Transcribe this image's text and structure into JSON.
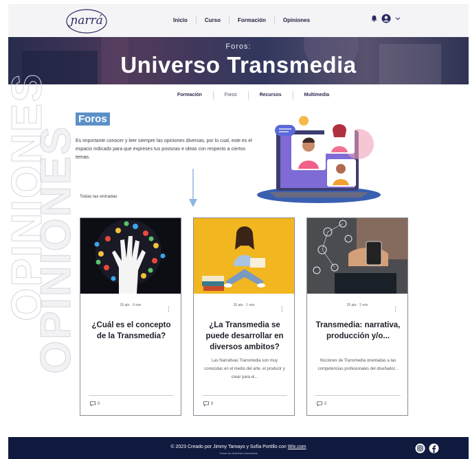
{
  "header": {
    "logo_text": "ɲarrá",
    "nav": [
      "Inicio",
      "Curso",
      "Formación",
      "Opiniones"
    ]
  },
  "banner": {
    "subtitle": "Foros:",
    "title": "Universo Transmedia"
  },
  "subnav": [
    "Formación",
    "Foros",
    "Recursos",
    "Multimedia"
  ],
  "watermark": "OPINIONES",
  "section_title": "Foros",
  "intro": "Es importante conocer y leer siempre las opiniones diversas, por lo cual, este es el espacio indicado para que expreses tus posturas e ideas con respecto a ciertos temas.",
  "all_entries": "Todas las entradas",
  "posts": [
    {
      "meta": "25 abr  ·  0 min",
      "title": "¿Cuál es el concepto de la Transmedia?",
      "excerpt": "",
      "comments": "0"
    },
    {
      "meta": "25 abr  ·  1 min",
      "title": "¿La Transmedia se puede desarrollar en diversos ambitos?",
      "excerpt": "Las Narrativas Transmedia son muy conocidas en el medio del arte, el producir y crear para el...",
      "comments": "0"
    },
    {
      "meta": "25 abr  ·  2 min",
      "title": "Transmedia: narrativa, producción y/o...",
      "excerpt": "Nociones de Transmedia orientadas a las competencias profesionales del diseñador...",
      "comments": "0"
    }
  ],
  "footer": {
    "copyright": "© 2023 Creado por Jimmy Tamayo y Sofía Portillo con",
    "link": "Wix.com",
    "rights": "Todos los derechos reservados"
  },
  "icons": [
    "bell-icon",
    "user-avatar-icon",
    "chevron-down-icon",
    "more-options-icon",
    "comment-icon",
    "instagram-icon",
    "facebook-icon",
    "down-arrow-icon"
  ],
  "colors": {
    "navy": "#0f1a3e",
    "accent_blue": "#5b90c7",
    "header_bg": "#f4f4f6"
  }
}
